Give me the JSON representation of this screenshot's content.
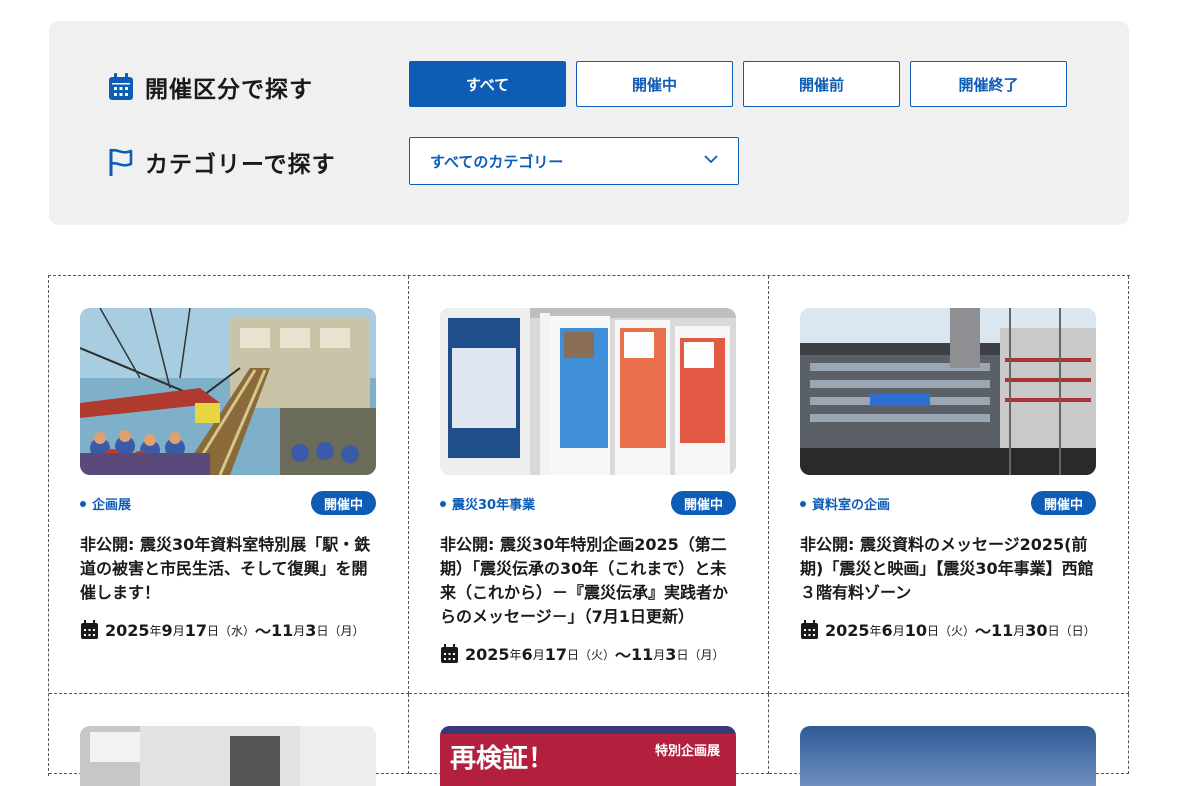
{
  "filters": {
    "status_label": "開催区分で探す",
    "category_label": "カテゴリーで探す",
    "status_buttons": [
      "すべて",
      "開催中",
      "開催前",
      "開催終了"
    ],
    "category_select": "すべてのカテゴリー"
  },
  "cards": [
    {
      "category": "企画展",
      "badge": "開催中",
      "title": "非公開: 震災30年資料室特別展「駅・鉄道の被害と市民生活、そして復興」を開催します！",
      "date": {
        "y": "2025",
        "m1": "9",
        "d1": "17",
        "w1": "（水）",
        "m2": "11",
        "d2": "3",
        "w2": "（月）"
      }
    },
    {
      "category": "震災30年事業",
      "badge": "開催中",
      "title": "非公開: 震災30年特別企画2025（第二期）「震災伝承の30年（これまで）と未来（これから）－『震災伝承』実践者からのメッセージ－」（7月1日更新）",
      "date": {
        "y": "2025",
        "m1": "6",
        "d1": "17",
        "w1": "（火）",
        "m2": "11",
        "d2": "3",
        "w2": "（月）"
      }
    },
    {
      "category": "資料室の企画",
      "badge": "開催中",
      "title": "非公開: 震災資料のメッセージ2025(前期)「震災と映画」【震災30年事業】西館３階有料ゾーン",
      "date": {
        "y": "2025",
        "m1": "6",
        "d1": "10",
        "w1": "（火）",
        "m2": "11",
        "d2": "30",
        "w2": "（日）"
      }
    }
  ],
  "partial_thumb_texts": {
    "kensho": "再検証！",
    "special": "特別企画展"
  },
  "units": {
    "year": "年",
    "month": "月",
    "day": "日",
    "tilde": "～"
  }
}
